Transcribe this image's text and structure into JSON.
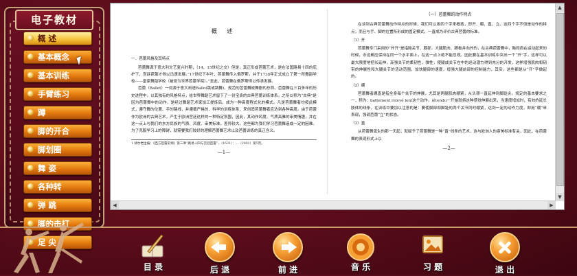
{
  "app": {
    "title": "电子教材"
  },
  "sidebar": {
    "items": [
      {
        "label": "概  述",
        "active": true
      },
      {
        "label": "基本概念"
      },
      {
        "label": "基本训练"
      },
      {
        "label": "手臂练习"
      },
      {
        "label": "蹲"
      },
      {
        "label": "脚的开合"
      },
      {
        "label": "脚划圈"
      },
      {
        "label": "舞  姿"
      },
      {
        "label": "各种转"
      },
      {
        "label": "弹  跳"
      },
      {
        "label": "脚的击打"
      },
      {
        "label": "足  尖"
      }
    ]
  },
  "document": {
    "left_page": {
      "heading": "概  述",
      "section": "一．芭蕾风格及其特点",
      "paragraphs": [
        "芭蕾舞源于意大利文艺复兴时期，（14、15世纪之交）但是，真正形成芭蕾艺术，是在法国路易十四的庇护下，宫廷芭蕾才得以迅速发展。”17世纪下半叶，芭蕾舞传入俄罗斯，并于1738年正式成立了第一所舞蹈学校——皇家舞蹈学校（被誉为世界芭蕾学院）。”至此，芭蕾舞在俄罗斯得以传承发展。",
        "芭蕾（Ballet）一词源于意大利语Ballo(跳或跳舞)，规范的芭蕾舞成舞剧的总称。芭蕾舞在三百多年的历史进程中，以其独有的风格特点，给世界舞蹈艺术留下了一份宝贵的古典芭蕾训练体系。之所以称为“古典”是因为芭蕾舞中的动作，是经过舞蹈艺术家加工提炼后，成为一种高度程式化的模式。凡是芭蕾舞者均按此模式，遵守舞的位置、手的路线，并遵循严格的、科学的训练体系，来创造芭蕾舞者应达到各种高度。由于芭蕾作为欧洲的古典艺术，产生于欧洲宫廷这样的一种特定氛围，因此，其动作风度、气质高雅的审美情趣，并在这一点上与我们的东方民族的气质、风度、审美标准，差异较大。这些都为我们学习芭蕾舞造成一定的困难。为了克服学习上的障碍，就需要我们较好的理解芭蕾舞艺术以及芭蕾训练的真正含义。"
      ],
      "footnote": "1 胡尔岩主编：《西方芭蕾史纲》第三章“路易十四与宫廷芭蕾”，（1631）：…（2002）第5页。",
      "page_number": "—1—"
    },
    "right_page": {
      "section": "（一）芭蕾舞的动作特点",
      "intro": "在谈到古典芭蕾舞动作特点的时候，我们可以用四个字来概括，即开、绷、直、立。这四个字不但是动作的特点，而且与手、脚的位置所形成的固定模式，一直成为评价古典芭蕾的标准。",
      "subsections": [
        {
          "title": "（1）开",
          "text": "芭蕾舞专门采用的“外开”是指胯关节、膝部、大腿肌肉、脚板并向外的，在古典芭蕾舞中，胯和肩在运动起来的时候，永远都应保持在同一个水平面上，在这一点上绝不能忽视。因此要在基本训练中突出一个“开”字，这样可以最大限度地把长延伸，渐强关节的柔韧性，弹性，使腿成关节在中的运动潜力得到充分的开发，这样增强肌肉和韧带的伸展性和大腿关节的活动范围，加快腿部的速度，增强大腿前部的控制能力，其实，这些都是从“开”字做起的。"
        },
        {
          "title": "（2）绷",
          "text": "芭蕾舞者绷直是指全身每个关节的伸展，尤其是两腿肌肉绷紧，从头颈一直延伸到脚趾尖。规定的基本要求之一，称为：battement relevé lent这个动作，从tendu一开始就将这种感觉伸展出来，当速度增加时，有效的延长肢体的线条，在训练中要加以注意的是：要使脚部和脚趾的两个关节同时绷紧，达到一定的动作力度，即用“绷”来表现，强调芭蕾“立”的状态。"
        },
        {
          "title": "（3）直",
          "text": "从芭蕾舞诞生的那一天起，就赋予了芭蕾舞是一种“直”线条的艺术，这与欧洲人的审美标准有关，因此，在芭蕾舞的表现形式上以"
        }
      ],
      "page_number": "—2—"
    }
  },
  "bottom_nav": [
    {
      "label": "目  录",
      "icon": "book-quill-icon"
    },
    {
      "label": "后  退",
      "icon": "arrow-left-icon"
    },
    {
      "label": "前  进",
      "icon": "arrow-right-icon"
    },
    {
      "label": "音  乐",
      "icon": "music-note-icon"
    },
    {
      "label": "习  题",
      "icon": "picture-icon"
    },
    {
      "label": "退  出",
      "icon": "close-icon"
    }
  ],
  "colors": {
    "background": "#5a0c1a",
    "menu_orange": "#e37a0e",
    "border_gold": "#c8a27a"
  }
}
